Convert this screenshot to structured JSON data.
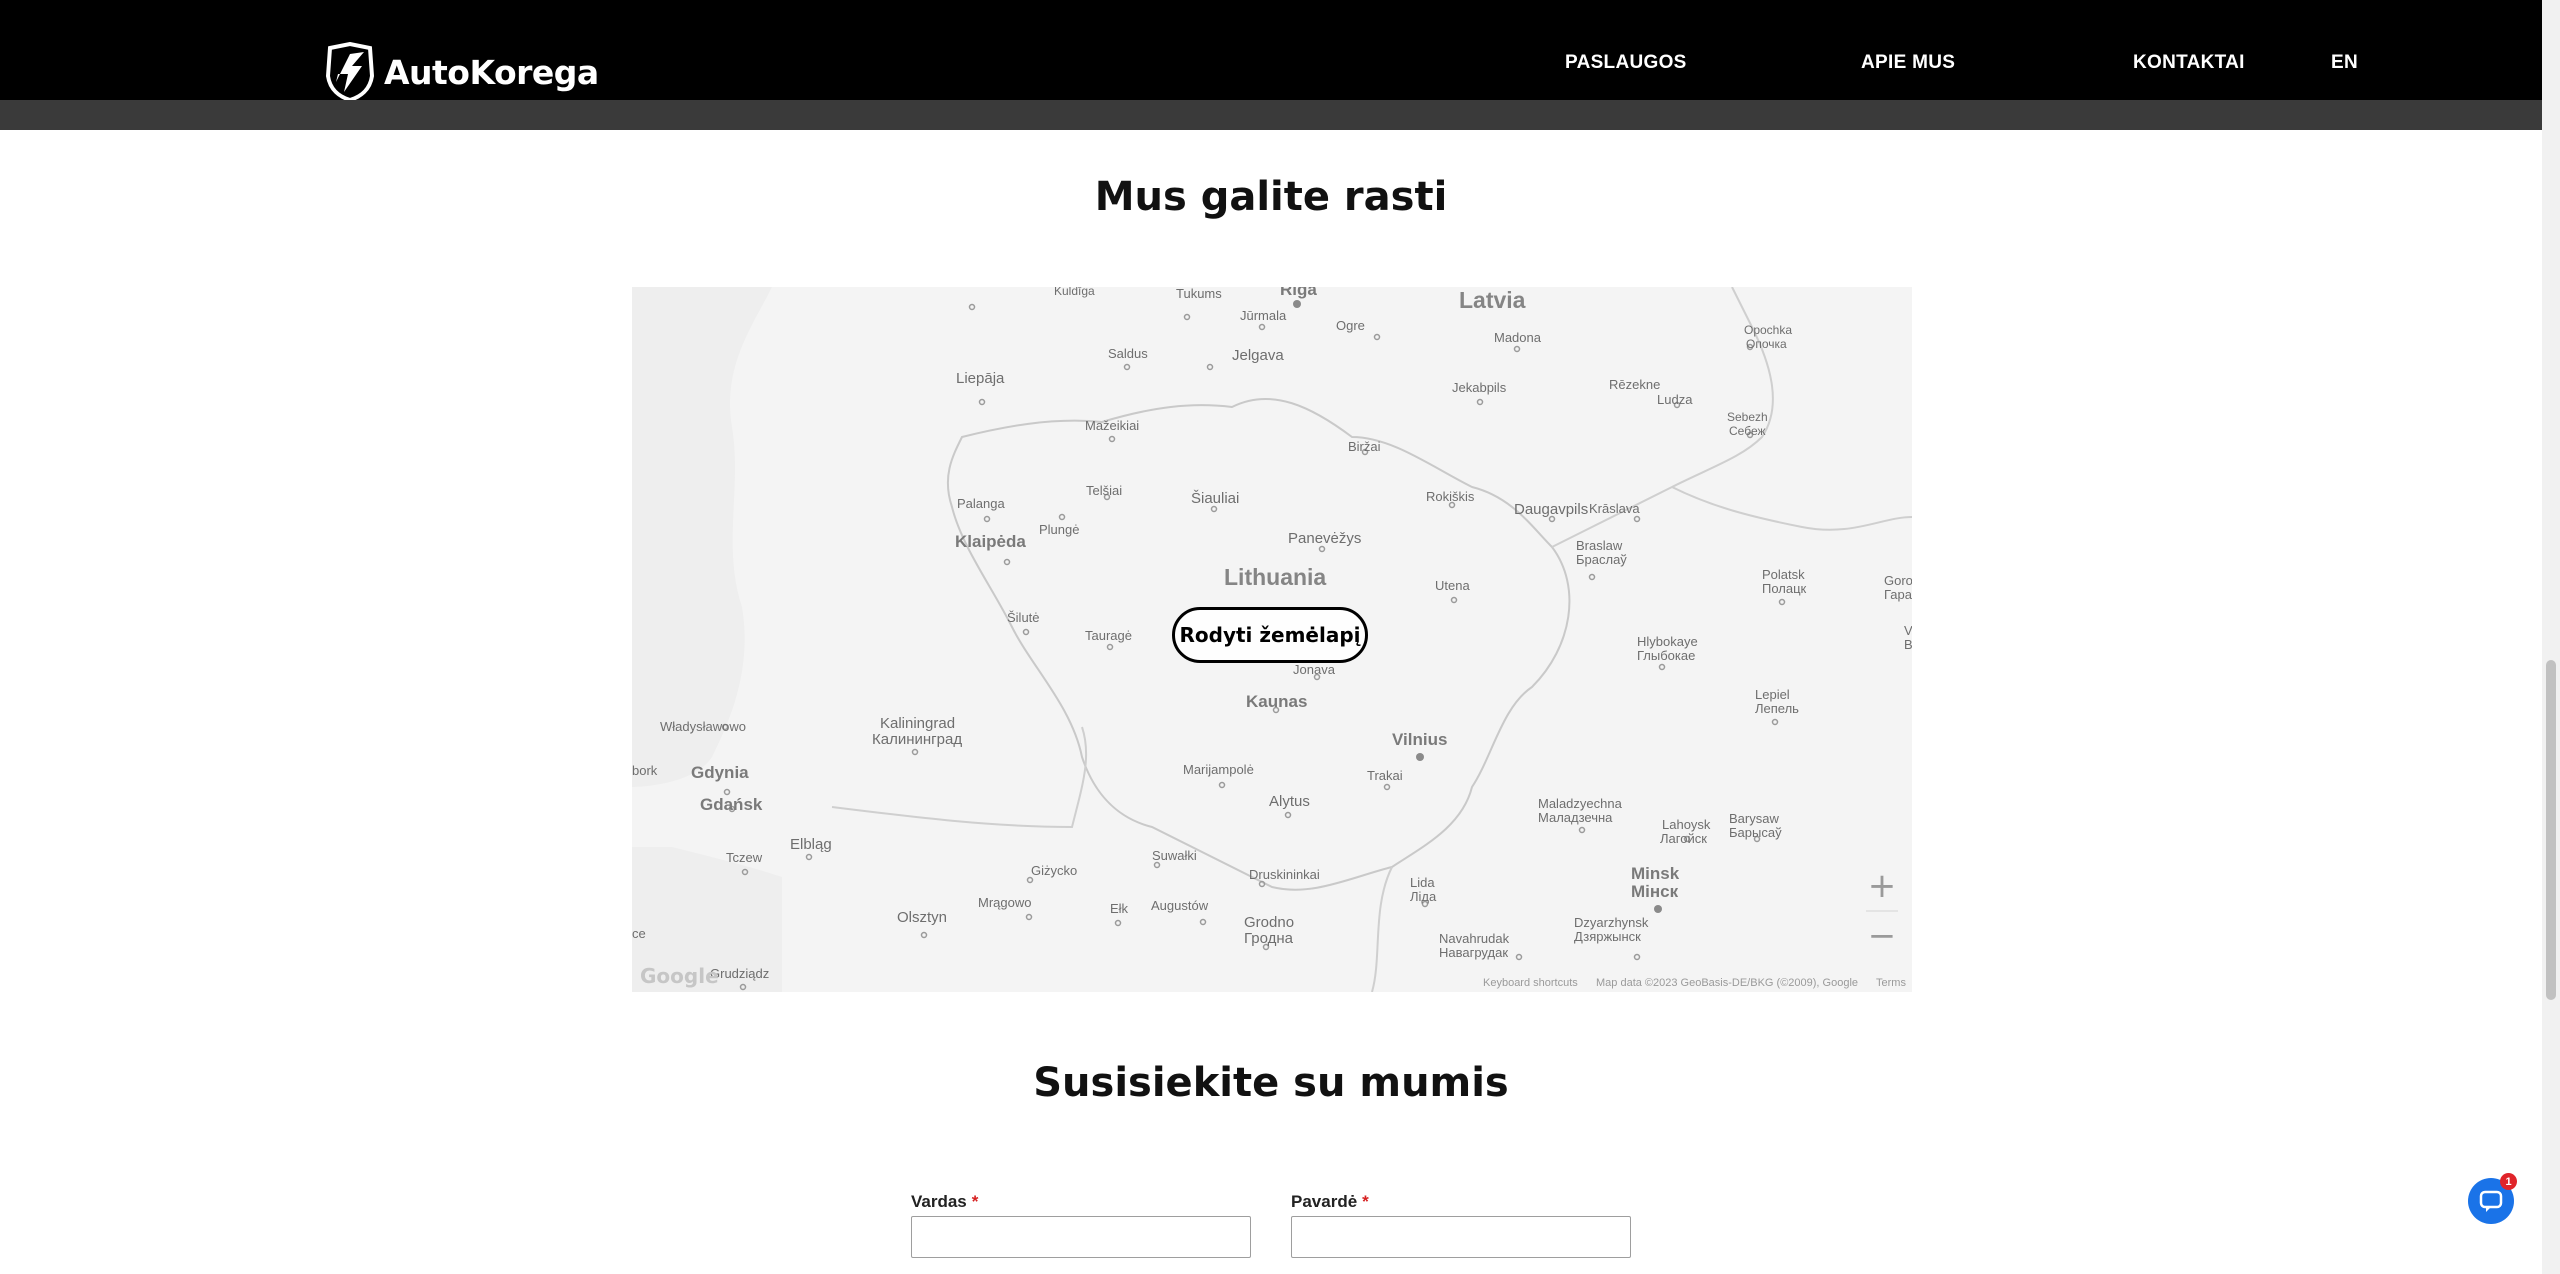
{
  "header": {
    "logo_text": "AutoKorega",
    "nav": {
      "services": "PASLAUGOS",
      "about": "APIE MUS",
      "contacts": "KONTAKTAI",
      "language": "EN"
    }
  },
  "map_section": {
    "title": "Mus galite rasti",
    "show_map_button": "Rodyti žemėlapį",
    "zoom_in": "+",
    "zoom_out": "−",
    "google_logo": "Google",
    "keyboard_shortcuts": "Keyboard shortcuts",
    "map_data": "Map data ©2023 GeoBasis-DE/BKG (©2009), Google",
    "terms": "Terms",
    "places": {
      "latvia": "Latvia",
      "lithuania": "Lithuania",
      "riga": "Riga",
      "kuldiga": "Kuldīga",
      "tukums": "Tukums",
      "jurmala": "Jūrmala",
      "ogre": "Ogre",
      "madona": "Madona",
      "opochka": "Opochka",
      "opochka_cyr": "Опочка",
      "saldus": "Saldus",
      "jelgava": "Jelgava",
      "liepaja": "Liepāja",
      "jekabpils": "Jekabpils",
      "rezekne": "Rēzekne",
      "ludza": "Ludza",
      "sebezh": "Sebezh",
      "sebezh_cyr": "Себеж",
      "mazeikiai": "Mažeikiai",
      "birzai": "Biržai",
      "telsiai": "Telšiai",
      "siauliai": "Šiauliai",
      "rokiskis": "Rokiškis",
      "daugavpils": "Daugavpils",
      "kraslava": "Krāslava",
      "palanga": "Palanga",
      "plunge": "Plungė",
      "klaipeda": "Klaipėda",
      "panevezys": "Panevėžys",
      "braslaw": "Braslaw",
      "braslaw_cyr": "Браслаў",
      "utena": "Utena",
      "polatsk": "Polatsk",
      "polatsk_cyr": "Полацк",
      "goro": "Goro",
      "goro_cyr": "Гара",
      "silute": "Šilutė",
      "taurage": "Tauragė",
      "jonava": "Jonava",
      "hlybokaye": "Hlybokaye",
      "hlybokaye_cyr": "Глыбокае",
      "kaunas": "Kaunas",
      "lepiel": "Lepiel",
      "lepiel_cyr": "Лепель",
      "wladyslawowo": "Władysławowo",
      "kaliningrad": "Kaliningrad",
      "kaliningrad_cyr": "Калининград",
      "vilnius": "Vilnius",
      "bork": "bork",
      "gdynia": "Gdynia",
      "marijampole": "Marijampolė",
      "trakai": "Trakai",
      "gdansk": "Gdańsk",
      "alytus": "Alytus",
      "maladzyechna": "Maladzyechna",
      "maladzyechna_cyr": "Маладзечна",
      "lahoysk": "Lahoysk",
      "lahoysk_cyr": "Лагойск",
      "barysaw": "Barysaw",
      "barysaw_cyr": "Барысаў",
      "elblag": "Elbląg",
      "tczew": "Tczew",
      "suwalki": "Suwałki",
      "gizycko": "Giżycko",
      "druskininkai": "Druskininkai",
      "lida": "Lida",
      "lida_cyr": "Ліда",
      "minsk": "Minsk",
      "minsk_cyr": "Мінск",
      "mragowo": "Mrągowo",
      "elk": "Ełk",
      "augustow": "Augustów",
      "olsztyn": "Olsztyn",
      "grodno": "Grodno",
      "grodno_cyr": "Гродна",
      "navahrudak": "Navahrudak",
      "navahrudak_cyr": "Навагрудак",
      "dzyarzhynsk": "Dzyarzhynsk",
      "dzyarzhynsk_cyr": "Дзяржынск",
      "ce": "ce",
      "grudziadz": "Grudziądz",
      "ve": "Ve",
      "be": "B"
    }
  },
  "contact_section": {
    "title": "Susisiekite su mumis",
    "first_name_label": "Vardas",
    "last_name_label": "Pavardė",
    "required_marker": "*"
  },
  "chat": {
    "badge_count": "1"
  },
  "colors": {
    "header_bg": "#000000",
    "header_strip": "#3a3a3a",
    "required": "#d61f1f",
    "chat_button": "#1a73e8",
    "chat_badge": "#e0242a"
  },
  "icons": {
    "logo": "shield-lightning-logo-icon",
    "chat": "chat-bubble-icon"
  }
}
